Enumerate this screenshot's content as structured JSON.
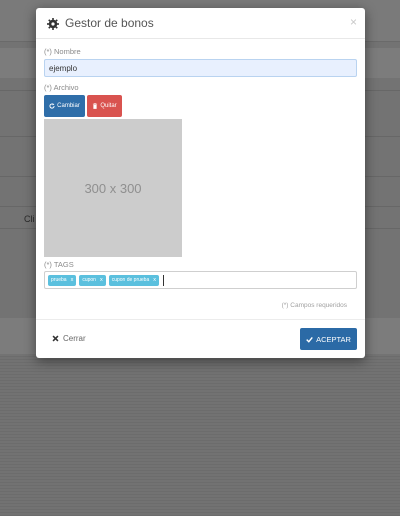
{
  "background": {
    "partial_text": "Cli"
  },
  "modal": {
    "title": "Gestor de bonos",
    "title_icon": "gear-icon",
    "close_label": "×",
    "nombre": {
      "label": "(*) Nombre",
      "value": "ejemplo"
    },
    "archivo": {
      "label": "(*) Archivo",
      "change_label": "Cambiar",
      "change_icon": "refresh-icon",
      "remove_label": "Quitar",
      "remove_icon": "trash-icon",
      "preview_text": "300 x 300"
    },
    "tags": {
      "label": "(*) TAGS",
      "items": [
        {
          "text": "prueba",
          "remove": "x"
        },
        {
          "text": "cupon",
          "remove": "x"
        },
        {
          "text": "cupon de prueba",
          "remove": "x"
        }
      ]
    },
    "required_note": "(*) Campos requeridos",
    "footer": {
      "close_label": "Cerrar",
      "close_icon": "times-icon",
      "accept_label": "ACEPTAR",
      "accept_icon": "check-icon"
    }
  },
  "colors": {
    "primary": "#2f6ea9",
    "danger": "#d9534f",
    "tag": "#5bc0de",
    "input_bg": "#e8f0fe"
  }
}
